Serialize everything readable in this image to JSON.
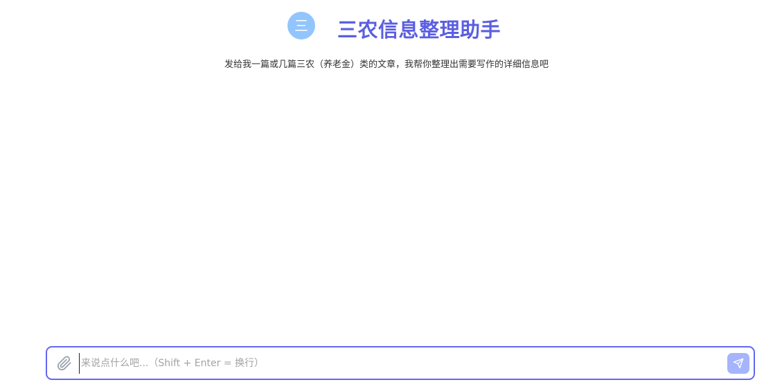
{
  "header": {
    "avatar_glyph": "三",
    "title": "三农信息整理助手"
  },
  "subtitle": "发给我一篇或几篇三农（养老金）类的文章，我帮你整理出需要写作的详细信息吧",
  "composer": {
    "placeholder": "来说点什么吧...（Shift + Enter = 换行）",
    "value": "",
    "attach_icon": "paperclip-icon",
    "send_icon": "send-icon"
  },
  "colors": {
    "accent": "#6366f1",
    "title": "#5b5fe0",
    "avatar_bg": "#93c5fd",
    "send_bg": "#a5b4fc"
  }
}
